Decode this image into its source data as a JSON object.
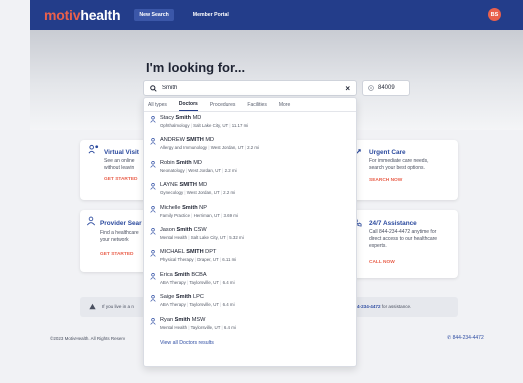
{
  "nav": {
    "logo_part1": "motiv",
    "logo_part2": "health",
    "new_search": "New Search",
    "member_portal": "Member Portal",
    "avatar_initials": "BS"
  },
  "hero": {
    "title": "I'm looking for..."
  },
  "search": {
    "query": "Smith",
    "zip": "84009"
  },
  "dropdown": {
    "tabs": [
      "All types",
      "Doctors",
      "Procedures",
      "Facilities",
      "More"
    ],
    "active_tab": "Doctors",
    "results": [
      {
        "pre": "Stacy ",
        "bold": "Smith",
        "post": " MD",
        "specialty": "Ophthalmology",
        "location": "Salt Lake City, UT",
        "distance": "11.17 mi"
      },
      {
        "pre": "ANDREW ",
        "bold": "SMITH",
        "post": " MD",
        "specialty": "Allergy and Immunology",
        "location": "West Jordan, UT",
        "distance": "2.2 mi"
      },
      {
        "pre": "Robin ",
        "bold": "Smith",
        "post": " MD",
        "specialty": "Neonatology",
        "location": "West Jordan, UT",
        "distance": "2.2 mi"
      },
      {
        "pre": "LAYNE ",
        "bold": "SMITH",
        "post": " MD",
        "specialty": "Gynecology",
        "location": "West Jordan, UT",
        "distance": "2.2 mi"
      },
      {
        "pre": "Michelle ",
        "bold": "Smith",
        "post": " NP",
        "specialty": "Family Practice",
        "location": "Herriman, UT",
        "distance": "3.69 mi"
      },
      {
        "pre": "Jason ",
        "bold": "Smith",
        "post": " CSW",
        "specialty": "Mental Health",
        "location": "Salt Lake City, UT",
        "distance": "5.32 mi"
      },
      {
        "pre": "MICHAEL ",
        "bold": "SMITH",
        "post": " DPT",
        "specialty": "Physical Therapy",
        "location": "Draper, UT",
        "distance": "6.11 mi"
      },
      {
        "pre": "Erica ",
        "bold": "Smith",
        "post": " BCBA",
        "specialty": "ABA Therapy",
        "location": "Taylorsville, UT",
        "distance": "6.4 mi"
      },
      {
        "pre": "Saige ",
        "bold": "Smith",
        "post": " LPC",
        "specialty": "ABA Therapy",
        "location": "Taylorsville, UT",
        "distance": "6.4 mi"
      },
      {
        "pre": "Ryan ",
        "bold": "Smith",
        "post": " MSW",
        "specialty": "Mental Health",
        "location": "Taylorsville, UT",
        "distance": "6.4 mi"
      }
    ],
    "view_all": "View all Doctors results"
  },
  "cards": {
    "virtual_visit": {
      "title": "Virtual Visit",
      "line1": "See an online",
      "line2": "without leavin",
      "link": "GET STARTED"
    },
    "urgent_care": {
      "title": "Urgent Care",
      "line1": "For immediate care needs,",
      "line2": "search your best options.",
      "link": "SEARCH NOW"
    },
    "provider_search": {
      "title": "Provider Sear",
      "line1": "Find a healthcare",
      "line2": "your network",
      "link": "GET STARTED"
    },
    "assistance": {
      "title": "24/7 Assistance",
      "line1": "Call 844-234-4472 anytime for",
      "line2": "direct access to our healthcare",
      "line3": "experts.",
      "link": "CALL NOW"
    }
  },
  "notice": {
    "left": "If you live in a n",
    "phone": "4-234-4472",
    "right": " for assistance."
  },
  "footer": {
    "copyright": "©2023 MotivHealth. All Rights Reserv",
    "phone": "844-234-4472"
  },
  "colors": {
    "nav_bg": "#233d8a",
    "accent": "#e9604c",
    "link": "#2e4da3"
  }
}
